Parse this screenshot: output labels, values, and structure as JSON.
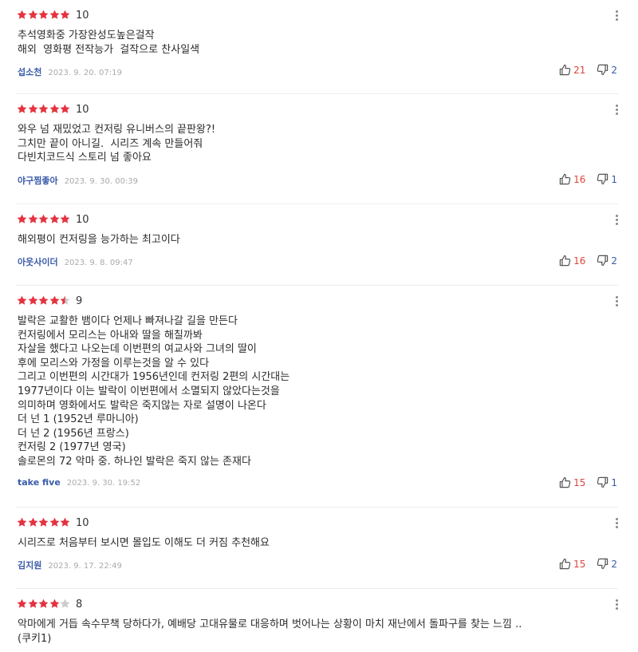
{
  "colors": {
    "star_filled": "#e4333f",
    "star_empty": "#cccccc",
    "author": "#3a5ba8",
    "upvote_count": "#e0443b",
    "downvote_count": "#3a5ba8"
  },
  "icons": {
    "star": "star-icon",
    "more": "more-vertical-icon",
    "thumbs_up": "thumbs-up-icon",
    "thumbs_down": "thumbs-down-icon"
  },
  "reviews": [
    {
      "stars": 5,
      "score": "10",
      "lines": [
        "추석영화중 가장완성도높은걸작",
        "해외  영화평 전작능가  걸작으로 찬사일색"
      ],
      "author": "섭소천",
      "date": "2023. 9. 20. 07:19",
      "likes": "21",
      "dislikes": "2"
    },
    {
      "stars": 5,
      "score": "10",
      "lines": [
        "와우 넘 재밌었고 컨저링 유니버스의 끝판왕?!",
        "그치만 끝이 아니길.  시리즈 계속 만들어줘",
        "다빈치코드식 스토리 넘 좋아요"
      ],
      "author": "야구찜좋아",
      "date": "2023. 9. 30. 00:39",
      "likes": "16",
      "dislikes": "1"
    },
    {
      "stars": 5,
      "score": "10",
      "lines": [
        "해외평이 컨저링을 능가하는 최고이다"
      ],
      "author": "아웃사이더",
      "date": "2023. 9. 8. 09:47",
      "likes": "16",
      "dislikes": "2"
    },
    {
      "stars": 4.5,
      "score": "9",
      "lines": [
        "발락은 교활한 뱀이다 언제나 빠져나갈 길을 만든다",
        "컨저링에서 모리스는 아내와 딸을 해칠까봐",
        "자살을 했다고 나오는데 이번편의 여교사와 그녀의 딸이",
        "후에 모리스와 가정을 이루는것을 알 수 있다",
        "그리고 이번편의 시간대가 1956년인데 컨저링 2편의 시간대는",
        "1977년이다 이는 발락이 이번편에서 소멸되지 않았다는것을",
        "의미하며 영화에서도 발락은 죽지않는 자로 설명이 나온다",
        "더 넌 1 (1952년 루마니아)",
        "더 넌 2 (1956년 프랑스)",
        "컨저링 2 (1977년 영국)",
        "솔로몬의 72 악마 중. 하나인 발락은 죽지 않는 존재다"
      ],
      "author": "take five",
      "date": "2023. 9. 30. 19:52",
      "likes": "15",
      "dislikes": "1"
    },
    {
      "stars": 5,
      "score": "10",
      "lines": [
        "시리즈로 처음부터 보시면 몰입도 이해도 더 커짐 추천해요"
      ],
      "author": "김지원",
      "date": "2023. 9. 17. 22:49",
      "likes": "15",
      "dislikes": "2"
    },
    {
      "stars": 4,
      "score": "8",
      "lines": [
        "악마에게 거듭 속수무책 당하다가, 예배당 고대유물로 대응하며 벗어나는 상황이 마치 재난에서 돌파구를 찾는 느낌 ..",
        "(쿠키1)"
      ],
      "author": "",
      "date": "",
      "likes": "",
      "dislikes": ""
    }
  ]
}
